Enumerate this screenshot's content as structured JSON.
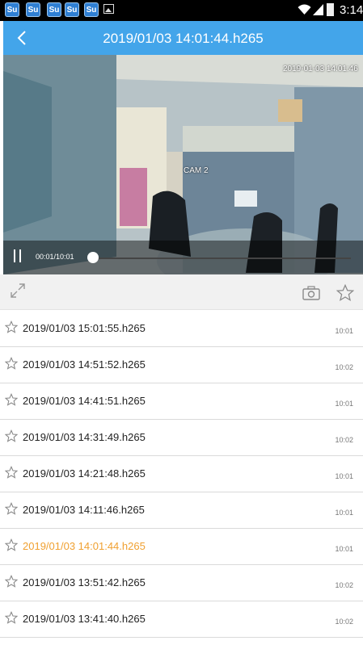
{
  "status_bar": {
    "time": "3:14",
    "notification_icons": [
      "app-notification-icon",
      "app-notification-icon",
      "app-notification-icon",
      "app-notification-icon",
      "app-notification-icon"
    ],
    "notification_glyph": "Su"
  },
  "header": {
    "title": "2019/01/03 14:01:44.h265"
  },
  "video": {
    "overlay_timestamp": "2019-01-03 14:01:46",
    "camera_label": "CAM 2",
    "playback_time": "00:01/10:01",
    "progress_fraction": 0.0017,
    "paused": false
  },
  "toolbar": {
    "icons": [
      "expand-icon",
      "camera-icon",
      "star-icon"
    ]
  },
  "files": [
    {
      "name": "2019/01/03 15:01:55.h265",
      "duration": "10:01",
      "active": false
    },
    {
      "name": "2019/01/03 14:51:52.h265",
      "duration": "10:02",
      "active": false
    },
    {
      "name": "2019/01/03 14:41:51.h265",
      "duration": "10:01",
      "active": false
    },
    {
      "name": "2019/01/03 14:31:49.h265",
      "duration": "10:02",
      "active": false
    },
    {
      "name": "2019/01/03 14:21:48.h265",
      "duration": "10:01",
      "active": false
    },
    {
      "name": "2019/01/03 14:11:46.h265",
      "duration": "10:01",
      "active": false
    },
    {
      "name": "2019/01/03 14:01:44.h265",
      "duration": "10:01",
      "active": true
    },
    {
      "name": "2019/01/03 13:51:42.h265",
      "duration": "10:02",
      "active": false
    },
    {
      "name": "2019/01/03 13:41:40.h265",
      "duration": "10:02",
      "active": false
    }
  ],
  "colors": {
    "accent": "#43a5ea",
    "active_item": "#f0a030"
  }
}
